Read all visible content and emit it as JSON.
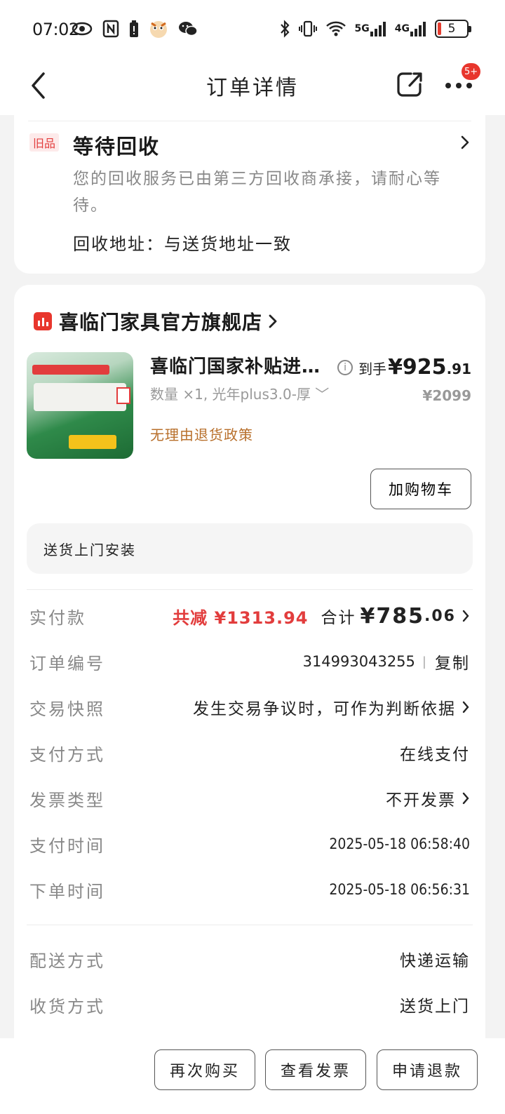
{
  "status_bar": {
    "time": "07:02",
    "network_5g": "5G",
    "network_4g": "4G",
    "battery": "5"
  },
  "nav": {
    "title": "订单详情",
    "more_badge": "5+"
  },
  "recycle": {
    "tag": "旧品",
    "title": "等待回收",
    "description": "您的回收服务已由第三方回收商承接，请耐心等待。",
    "address": "回收地址：与送货地址一致"
  },
  "shop": {
    "name": "喜临门家具官方旗舰店"
  },
  "product": {
    "title": "喜临门国家补贴进口…",
    "spec": "数量 ×1, 光年plus3.0-厚 ﹀",
    "policy": "无理由退货政策",
    "price_label": "到手",
    "price_main": "¥925",
    "price_cents": ".91",
    "original_price": "¥2099",
    "info_icon": "i",
    "add_cart_label": "加购物车"
  },
  "service": "送货上门安装",
  "summary": {
    "paid_label": "实付款",
    "reduce_text": "共减 ¥1313.94",
    "total_label": "合计",
    "total_main": "¥785",
    "total_cents": ".06",
    "order_no_label": "订单编号",
    "order_no": "314993043255",
    "copy_label": "复制",
    "snapshot_label": "交易快照",
    "snapshot_value": "发生交易争议时，可作为判断依据",
    "pay_method_label": "支付方式",
    "pay_method_value": "在线支付",
    "invoice_label": "发票类型",
    "invoice_value": "不开发票",
    "pay_time_label": "支付时间",
    "pay_time_value": "2025-05-18 06:58:40",
    "order_time_label": "下单时间",
    "order_time_value": "2025-05-18 06:56:31",
    "delivery_label": "配送方式",
    "delivery_value": "快递运输",
    "receive_label": "收货方式",
    "receive_value": "送货上门"
  },
  "actions": {
    "rebuy": "再次购买",
    "view_invoice": "查看发票",
    "refund": "申请退款"
  },
  "colors": {
    "accent_red": "#e23d3d",
    "policy_brown": "#b8702c"
  }
}
